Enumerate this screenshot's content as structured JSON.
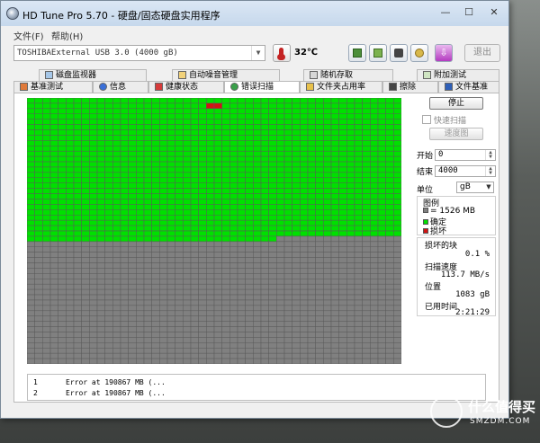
{
  "window": {
    "title": "HD Tune Pro 5.70 - 硬盘/固态硬盘实用程序"
  },
  "window_controls": {
    "minimize": "—",
    "maximize": "☐",
    "close": "✕"
  },
  "menu": [
    "文件(F)",
    "帮助(H)"
  ],
  "toolbar": {
    "drive": "TOSHIBAExternal USB 3.0 (4000 gB)",
    "temperature": "32℃",
    "exit_label": "退出",
    "icons": [
      "copy-info-icon",
      "copy-all-icon",
      "screenshot-icon",
      "save-icon",
      "download-icon"
    ]
  },
  "tabs_row1": [
    "磁盘监视器",
    "自动噪音管理",
    "随机存取",
    "附加测试"
  ],
  "tabs_row2": [
    "基准测试",
    "信息",
    "健康状态",
    "错误扫描",
    "文件夹占用率",
    "擦除",
    "文件基准"
  ],
  "active_tab": "错误扫描",
  "scan": {
    "grid_cols": 48,
    "grid_rows": 50,
    "scanned_blocks": 1280,
    "damaged_blocks": [
      {
        "row": 1,
        "col": 23
      },
      {
        "row": 1,
        "col": 24
      }
    ],
    "colors": {
      "ok": "#00e000",
      "bad": "#d21313",
      "unscanned": "#808080",
      "line": "#5a5a5a"
    }
  },
  "controls": {
    "stop_label": "停止",
    "quick_scan_label": "快速扫描",
    "speed_map_label": "速度图",
    "start_label": "开始",
    "start_value": "0",
    "end_label": "结束",
    "end_value": "4000",
    "unit_label": "单位",
    "unit_value": "gB"
  },
  "legend": {
    "title": "图例",
    "block_size": "= 1526 MB",
    "ok_label": "确定",
    "bad_label": "损坏"
  },
  "stats": {
    "damaged_title": "损坏的块",
    "damaged_value": "0.1 %",
    "speed_label": "扫描速度",
    "speed_value": "113.7 MB/s",
    "position_label": "位置",
    "position_value": "1083 gB",
    "elapsed_label": "已用时间",
    "elapsed_value": "2:21:29"
  },
  "log": [
    {
      "num": "1",
      "text": "Error at 190867 MB (..."
    },
    {
      "num": "2",
      "text": "Error at 190867 MB (..."
    }
  ],
  "watermark": {
    "text": "什么值得买",
    "sub": "SMZDM.COM"
  }
}
